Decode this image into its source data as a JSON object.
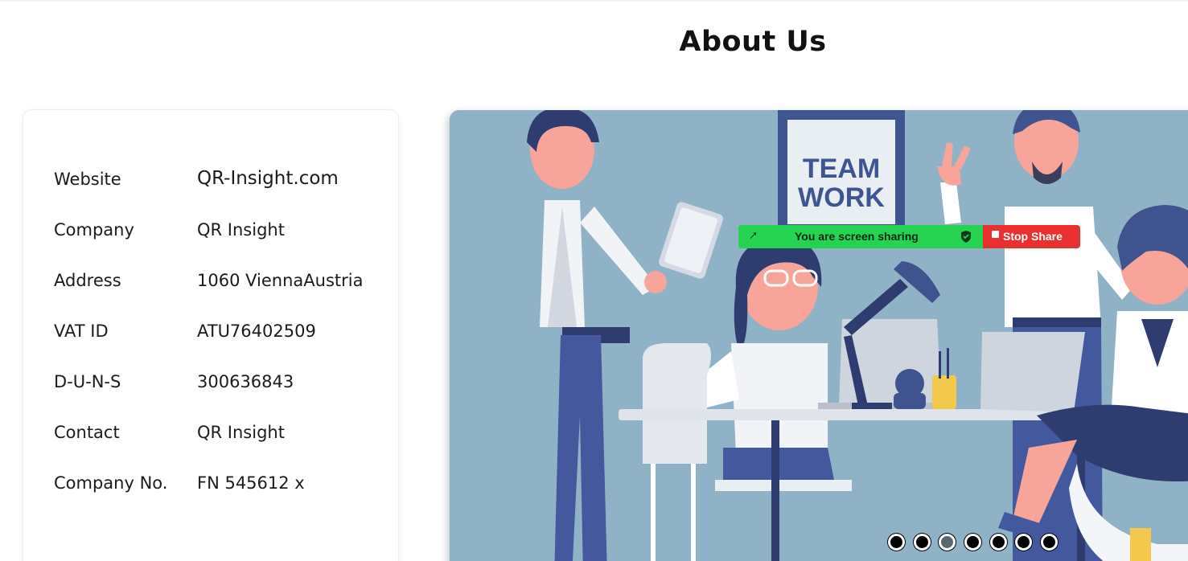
{
  "page": {
    "title": "About Us"
  },
  "info": [
    {
      "label": "Website",
      "value": "QR-Insight.com"
    },
    {
      "label": "Company",
      "value": "QR Insight"
    },
    {
      "label": "Address",
      "value": "1060 ViennaAustria"
    },
    {
      "label": "VAT ID",
      "value": "ATU76402509"
    },
    {
      "label": "D-U-N-S",
      "value": "300636843"
    },
    {
      "label": "Contact",
      "value": "QR Insight"
    },
    {
      "label": "Company No.",
      "value": "FN 545612 x"
    }
  ],
  "carousel": {
    "poster_line1": "TEAM",
    "poster_line2": "WORK",
    "slide_count": 7,
    "active_slide": 3
  },
  "share_bar": {
    "message": "You are screen sharing",
    "stop_label": "Stop Share",
    "arrow_icon": "arrow-icon",
    "shield_icon": "shield-icon",
    "colors": {
      "bar": "#26d252",
      "stop": "#e8302f"
    }
  }
}
